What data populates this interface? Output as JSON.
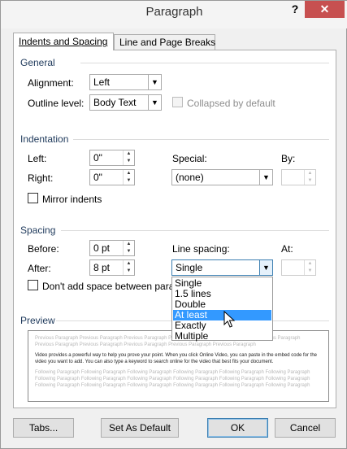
{
  "window": {
    "title": "Paragraph",
    "help_label": "?",
    "close_label": "✕"
  },
  "tabs": [
    {
      "label": "Indents and Spacing",
      "active": true
    },
    {
      "label": "Line and Page Breaks",
      "active": false
    }
  ],
  "general": {
    "title": "General",
    "alignment": {
      "label": "Alignment:",
      "value": "Left"
    },
    "outline_level": {
      "label": "Outline level:",
      "value": "Body Text"
    },
    "collapsed": {
      "label": "Collapsed by default",
      "checked": false,
      "enabled": false
    }
  },
  "indentation": {
    "title": "Indentation",
    "left": {
      "label": "Left:",
      "value": "0\""
    },
    "right": {
      "label": "Right:",
      "value": "0\""
    },
    "special": {
      "label": "Special:",
      "value": "(none)"
    },
    "by": {
      "label": "By:",
      "value": ""
    },
    "mirror": {
      "label": "Mirror indents",
      "checked": false
    }
  },
  "spacing": {
    "title": "Spacing",
    "before": {
      "label": "Before:",
      "value": "0 pt"
    },
    "after": {
      "label": "After:",
      "value": "8 pt"
    },
    "line_spacing": {
      "label": "Line spacing:",
      "value": "Single"
    },
    "at": {
      "label": "At:",
      "value": ""
    },
    "dont_add": {
      "label": "Don't add space between parag",
      "checked": false
    },
    "line_spacing_options": [
      "Single",
      "1.5 lines",
      "Double",
      "At least",
      "Exactly",
      "Multiple"
    ],
    "highlighted_option": "At least"
  },
  "preview": {
    "title": "Preview",
    "prev_line1": "Previous Paragraph Previous Paragraph Previous Paragraph Previous Paragraph Previous Paragraph Previous Paragraph",
    "prev_line2": "Previous Paragraph Previous Paragraph Previous Paragraph Previous Paragraph Previous Paragraph",
    "main_text": "Video provides a powerful way to help you prove your point. When you click Online Video, you can paste in the embed code for the video you want to add. You can also type a keyword to search online for the video that best fits your document.",
    "next_line1": "Following Paragraph Following Paragraph Following Paragraph Following Paragraph Following Paragraph Following Paragraph",
    "next_line2": "Following Paragraph Following Paragraph Following Paragraph Following Paragraph Following Paragraph Following Paragraph",
    "next_line3": "Following Paragraph Following Paragraph Following Paragraph Following Paragraph Following Paragraph Following Paragraph"
  },
  "buttons": {
    "tabs": "Tabs...",
    "set_as_default": "Set As Default",
    "ok": "OK",
    "cancel": "Cancel"
  },
  "colors": {
    "section_title": "#1e395b",
    "highlight": "#3399ff",
    "close": "#c75050",
    "focus": "#3c7fb1"
  }
}
